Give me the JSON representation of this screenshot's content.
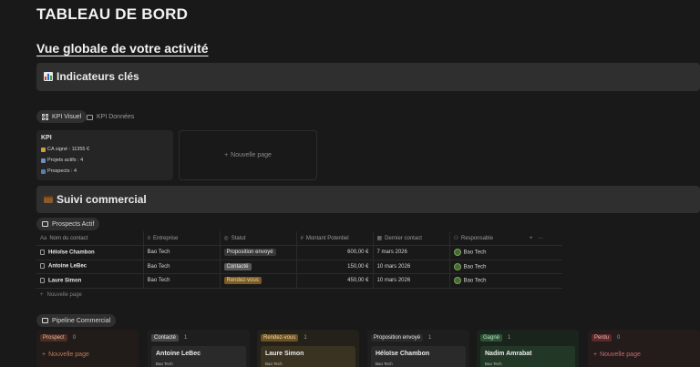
{
  "page": {
    "title": "TABLEAU DE BORD",
    "subtitle": "Vue globale de votre activité"
  },
  "indicators": {
    "heading": "Indicateurs clés",
    "icon": "bar-chart-icon",
    "views": [
      {
        "label": "KPI Visuel",
        "active": true
      },
      {
        "label": "KPI Données",
        "active": false
      }
    ],
    "kpi_card": {
      "title": "KPI",
      "lines": [
        {
          "icon": "money-bag-icon",
          "text": "CA signé : 11355 €"
        },
        {
          "icon": "folder-icon",
          "text": "Projets actifs : 4"
        },
        {
          "icon": "people-icon",
          "text": "Prospects : 4"
        }
      ]
    },
    "new_page_label": "Nouvelle page"
  },
  "suivi": {
    "heading": "Suivi commercial",
    "icon": "briefcase-icon"
  },
  "prospects": {
    "view_label": "Prospects Actif",
    "columns": [
      "Nom du contact",
      "Entreprise",
      "Statut",
      "Montant Potentiel",
      "Dernier contact",
      "Responsable"
    ],
    "rows": [
      {
        "name": "Héloïse Chambon",
        "company": "Bao Tech",
        "status": "Proposition envoyé",
        "amount": "600,00 €",
        "last_contact": "7 mars 2026",
        "owner": "Bao Tech"
      },
      {
        "name": "Antoine LeBec",
        "company": "Bao Tech",
        "status": "Contacté",
        "amount": "150,00 €",
        "last_contact": "10 mars 2026",
        "owner": "Bao Tech"
      },
      {
        "name": "Laure Simon",
        "company": "Bao Tech",
        "status": "Rendez-vous",
        "amount": "450,00 €",
        "last_contact": "10 mars 2026",
        "owner": "Bao Tech"
      }
    ],
    "new_row_label": "Nouvelle page",
    "add_symbol": "+",
    "more_symbol": "···"
  },
  "pipeline": {
    "view_label": "Pipeline Commercial",
    "columns": [
      {
        "label": "Prospect",
        "count": "0",
        "card_title": "",
        "card_sub": "",
        "new_label": "Nouvelle page"
      },
      {
        "label": "Contacté",
        "count": "1",
        "card_title": "Antoine LeBec",
        "card_sub": "Bao Tech",
        "new_label": ""
      },
      {
        "label": "Rendez-vous",
        "count": "1",
        "card_title": "Laure Simon",
        "card_sub": "Bao Tech",
        "new_label": ""
      },
      {
        "label": "Proposition envoyé",
        "count": "1",
        "card_title": "Héloïse Chambon",
        "card_sub": "Bao Tech",
        "new_label": ""
      },
      {
        "label": "Gagné",
        "count": "1",
        "card_title": "Nadim Amrabat",
        "card_sub": "Bao Tech",
        "new_label": ""
      },
      {
        "label": "Perdu",
        "count": "0",
        "card_title": "",
        "card_sub": "",
        "new_label": "Nouvelle page"
      }
    ]
  },
  "colors": {
    "background": "#191919",
    "callout": "#2f2f2f",
    "status_proposition": "#373737",
    "status_contacte": "#5a5a5a",
    "status_rdv": "#7a5b24",
    "prospect": "#4b2f24",
    "rdv": "#3e3621",
    "gagne": "#233727",
    "perdu": "#3d2323"
  }
}
